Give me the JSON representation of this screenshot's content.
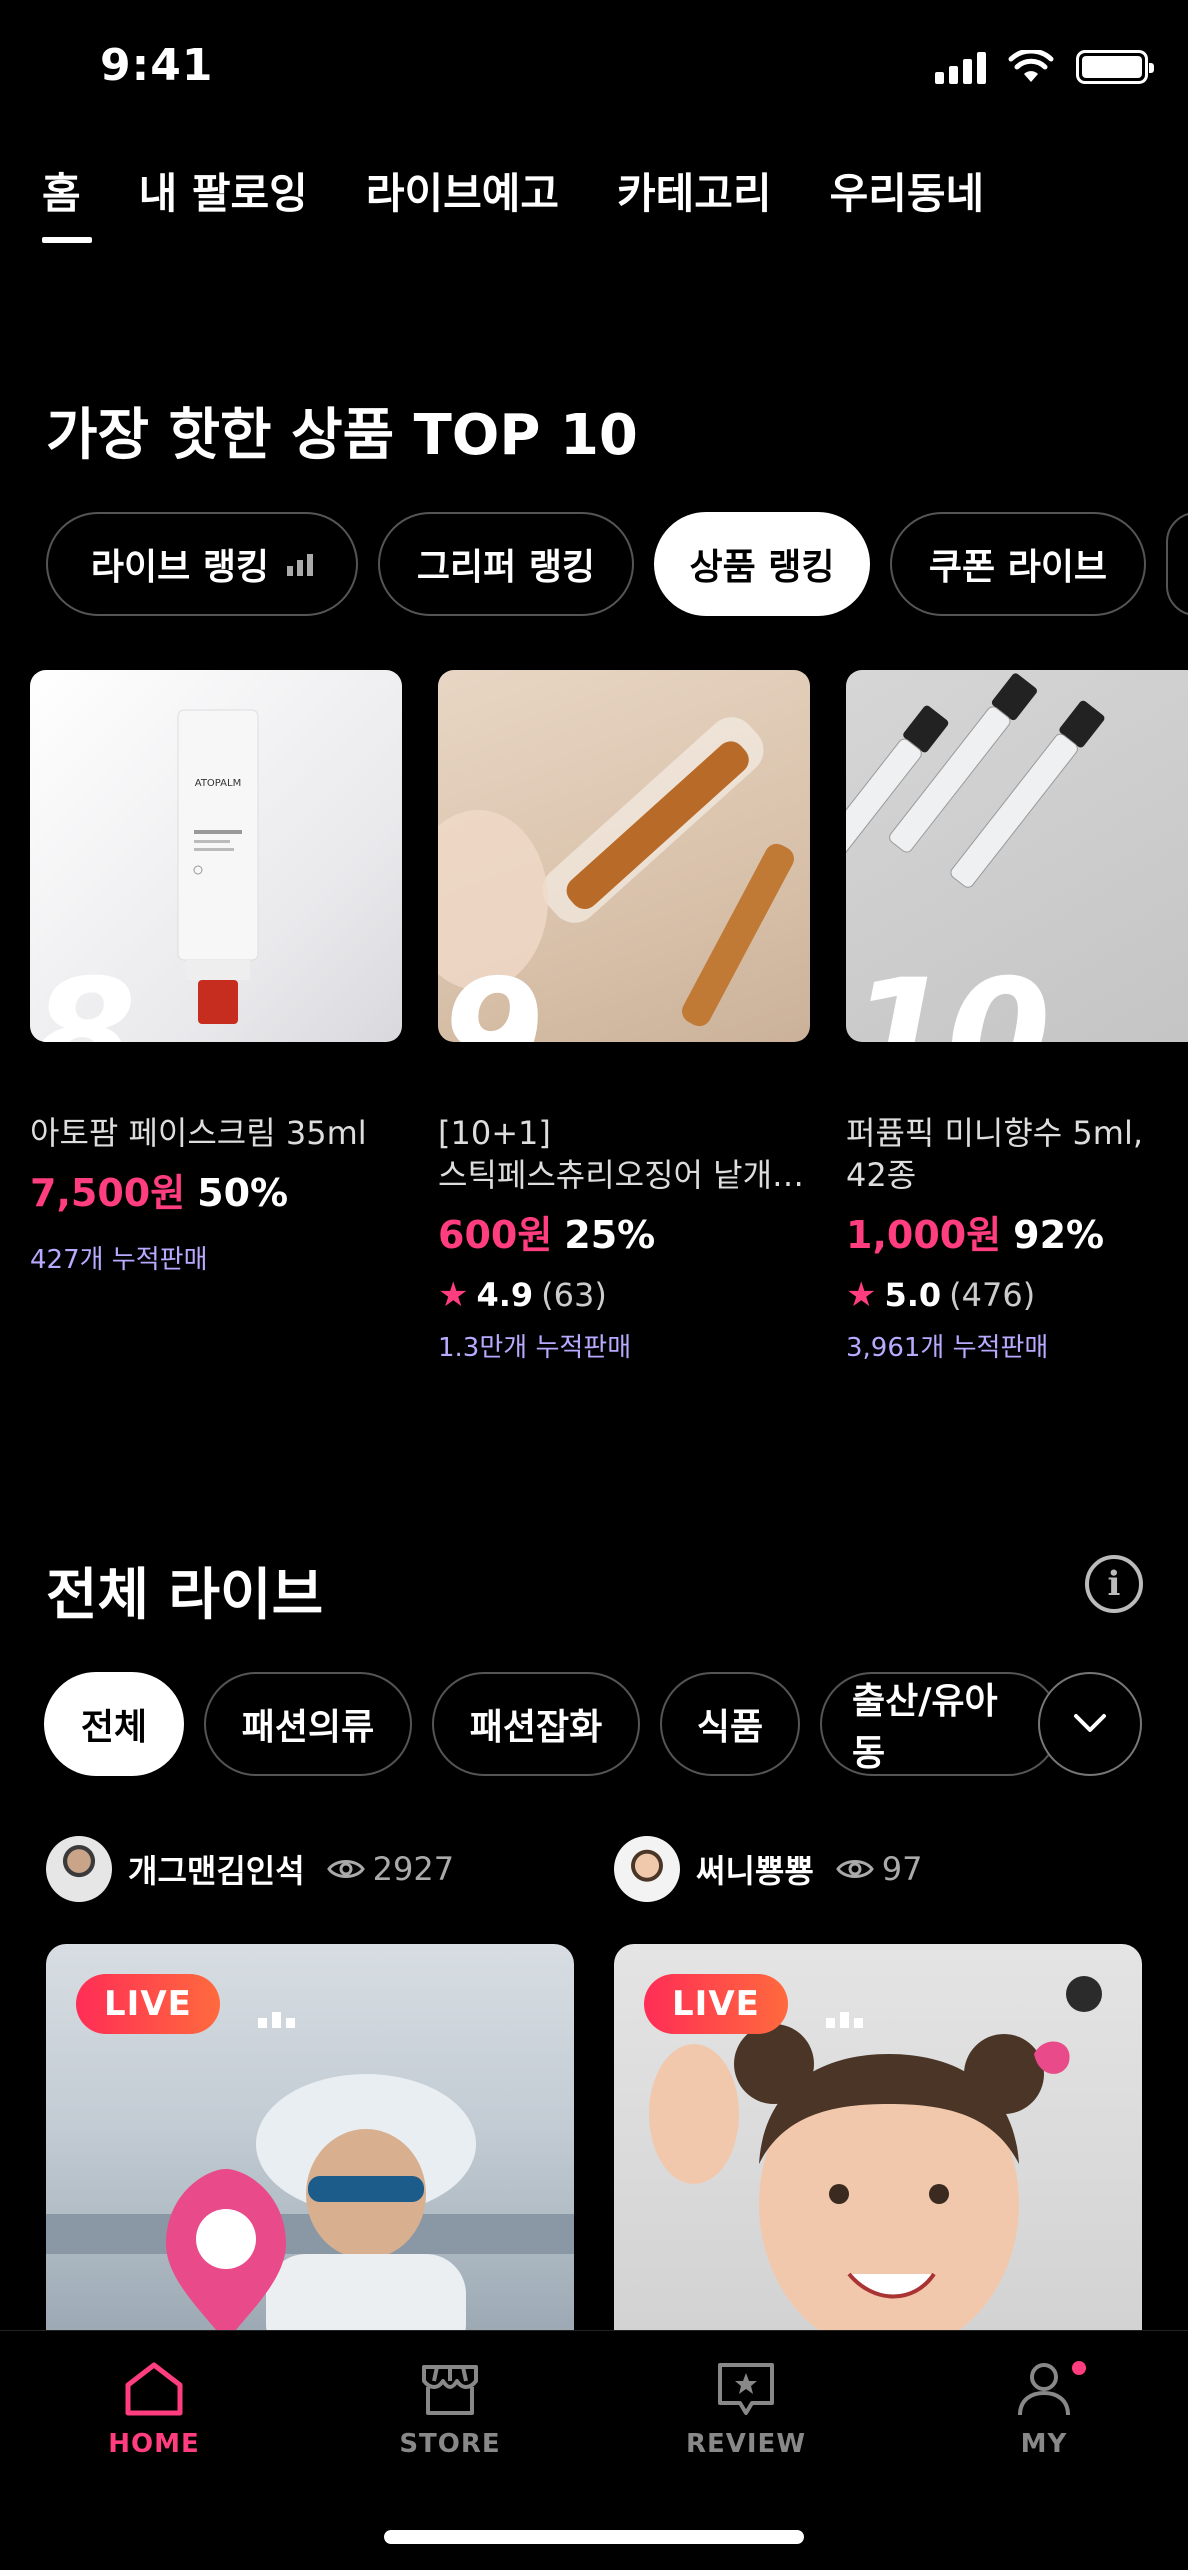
{
  "status_bar": {
    "time": "9:41"
  },
  "top_tabs": [
    "홈",
    "내 팔로잉",
    "라이브예고",
    "카테고리",
    "우리동네"
  ],
  "ranking": {
    "title": "가장 핫한 상품 TOP 10",
    "chips": [
      "라이브 랭킹",
      "그리퍼 랭킹",
      "상품 랭킹",
      "쿠폰 라이브"
    ],
    "active_chip": "상품 랭킹",
    "products": [
      {
        "rank": "8",
        "name": "아토팜 페이스크림 35ml",
        "price": "7,500원",
        "discount": "50%",
        "sold": "427개 누적판매",
        "image_brand": "ATOPALM"
      },
      {
        "rank": "9",
        "name": "[10+1]\n스틱페스츄리오징어 낱개…",
        "price": "600원",
        "discount": "25%",
        "rating": "4.9",
        "reviews": "(63)",
        "sold": "1.3만개 누적판매"
      },
      {
        "rank": "10",
        "name": "퍼퓸픽 미니향수 5ml,\n42종",
        "price": "1,000원",
        "discount": "92%",
        "rating": "5.0",
        "reviews": "(476)",
        "sold": "3,961개 누적판매"
      }
    ]
  },
  "live": {
    "title": "전체 라이브",
    "categories": [
      "전체",
      "패션의류",
      "패션잡화",
      "식품",
      "출산/유아동"
    ],
    "active_category": "전체",
    "streams": [
      {
        "streamer": "개그맨김인석",
        "viewers": "2927",
        "badge": "LIVE"
      },
      {
        "streamer": "써니뿅뿅",
        "viewers": "97",
        "badge": "LIVE"
      }
    ]
  },
  "bottom_nav": {
    "items": [
      "HOME",
      "STORE",
      "REVIEW",
      "MY"
    ],
    "active": "HOME"
  },
  "colors": {
    "accent": "#ff3d7f",
    "sold_text": "#b9a9ff",
    "background": "#000000"
  }
}
